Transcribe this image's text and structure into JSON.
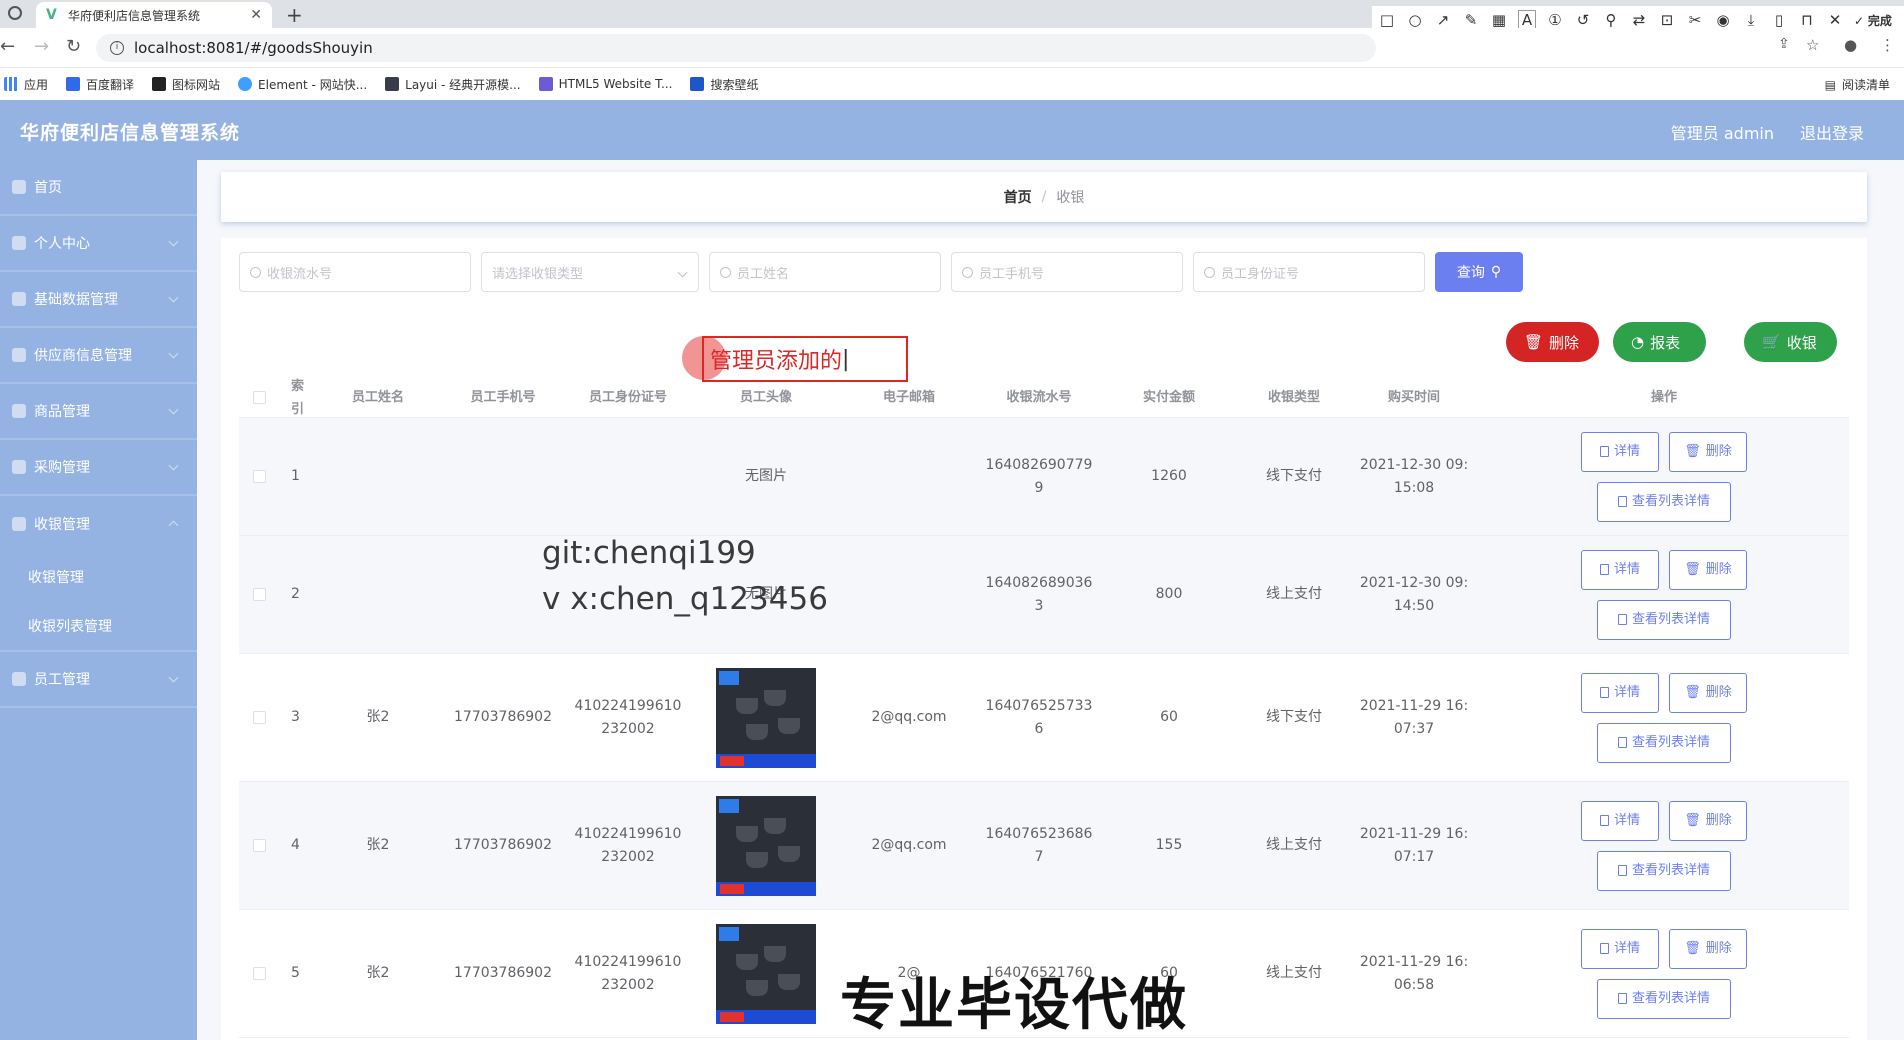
{
  "browser": {
    "tab_title": "华府便利店信息管理系统",
    "url": "localhost:8081/#/goodsShouyin",
    "bookmarks": [
      "应用",
      "百度翻译",
      "图标网站",
      "Element - 网站快...",
      "Layui - 经典开源模...",
      "HTML5 Website T...",
      "搜索壁纸"
    ],
    "reading_list": "阅读清单"
  },
  "annotation_toolbar": {
    "font_size": "18",
    "done_label": "完成",
    "current_color": "#f0383b"
  },
  "header": {
    "title": "华府便利店信息管理系统",
    "user": "管理员 admin",
    "logout": "退出登录"
  },
  "sidebar": {
    "items": [
      {
        "label": "首页"
      },
      {
        "label": "个人中心"
      },
      {
        "label": "基础数据管理"
      },
      {
        "label": "供应商信息管理"
      },
      {
        "label": "商品管理"
      },
      {
        "label": "采购管理"
      },
      {
        "label": "收银管理"
      }
    ],
    "subitems": [
      "收银管理",
      "收银列表管理"
    ],
    "last_item": "员工管理"
  },
  "breadcrumb": {
    "home": "首页",
    "current": "收银"
  },
  "search": {
    "serial_placeholder": "收银流水号",
    "type_placeholder": "请选择收银类型",
    "name_placeholder": "员工姓名",
    "phone_placeholder": "员工手机号",
    "idcard_placeholder": "员工身份证号",
    "query_label": "查询"
  },
  "actions": {
    "delete": "删除",
    "report": "报表",
    "checkout": "收银"
  },
  "table": {
    "headers": [
      "索引",
      "员工姓名",
      "员工手机号",
      "员工身份证号",
      "员工头像",
      "电子邮箱",
      "收银流水号",
      "实付金额",
      "收银类型",
      "购买时间",
      "操作"
    ],
    "op_detail": "详情",
    "op_delete": "删除",
    "op_list_detail": "查看列表详情",
    "rows": [
      {
        "idx": "1",
        "name": "",
        "phone": "",
        "idcard1": "",
        "idcard2": "",
        "avatar": "无图片",
        "email": "",
        "serial1": "164082690779",
        "serial2": "9",
        "amount": "1260",
        "type": "线下支付",
        "time1": "2021-12-30 09:",
        "time2": "15:08"
      },
      {
        "idx": "2",
        "name": "",
        "phone": "",
        "idcard1": "",
        "idcard2": "",
        "avatar": "无图片",
        "email": "",
        "serial1": "164082689036",
        "serial2": "3",
        "amount": "800",
        "type": "线上支付",
        "time1": "2021-12-30 09:",
        "time2": "14:50"
      },
      {
        "idx": "3",
        "name": "张2",
        "phone": "17703786902",
        "idcard1": "410224199610",
        "idcard2": "232002",
        "avatar": "",
        "email": "2@qq.com",
        "serial1": "164076525733",
        "serial2": "6",
        "amount": "60",
        "type": "线下支付",
        "time1": "2021-11-29 16:",
        "time2": "07:37"
      },
      {
        "idx": "4",
        "name": "张2",
        "phone": "17703786902",
        "idcard1": "410224199610",
        "idcard2": "232002",
        "avatar": "",
        "email": "2@qq.com",
        "serial1": "164076523686",
        "serial2": "7",
        "amount": "155",
        "type": "线上支付",
        "time1": "2021-11-29 16:",
        "time2": "07:17"
      },
      {
        "idx": "5",
        "name": "张2",
        "phone": "17703786902",
        "idcard1": "410224199610",
        "idcard2": "232002",
        "avatar": "",
        "email": "2@",
        "serial1": "164076521760",
        "serial2": "",
        "amount": "60",
        "type": "线上支付",
        "time1": "2021-11-29 16:",
        "time2": "06:58"
      }
    ]
  },
  "overlays": {
    "annotation_text": "管理员添加的",
    "watermark_line1": "git:chenqi199",
    "watermark_line2": "v x:chen_q123456",
    "watermark_bottom": "专业毕设代做"
  }
}
